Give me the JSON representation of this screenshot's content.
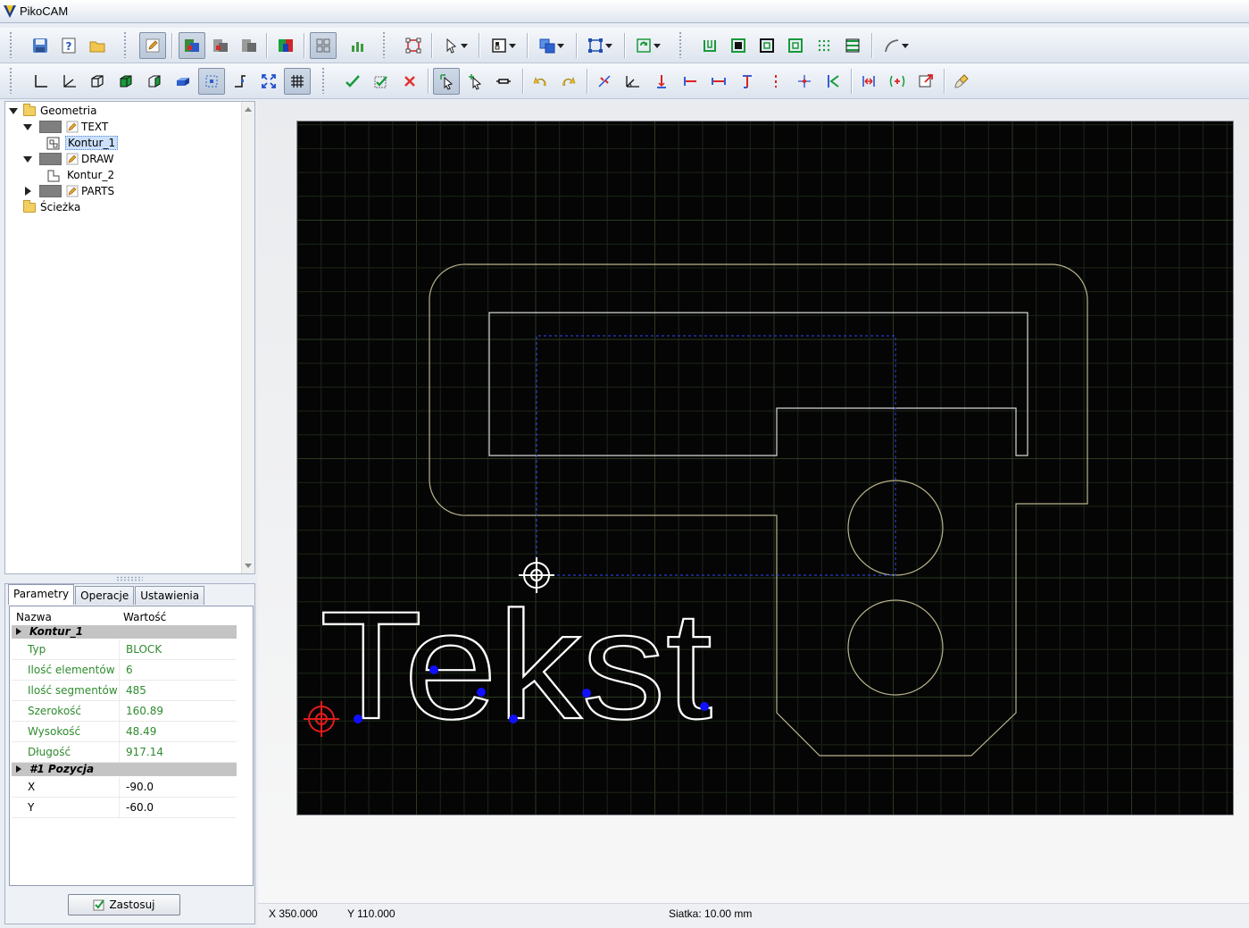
{
  "app": {
    "title": "PikoCAM"
  },
  "tree": {
    "root_label": "Geometria",
    "layer_text": "TEXT",
    "item_kontur1": "Kontur_1",
    "layer_draw": "DRAW",
    "item_kontur2": "Kontur_2",
    "layer_parts": "PARTS",
    "path_label": "Ścieżka"
  },
  "tabs": [
    "Parametry",
    "Operacje",
    "Ustawienia"
  ],
  "properties": {
    "col_name": "Nazwa",
    "col_value": "Wartość",
    "group1": "Kontur_1",
    "rows": [
      {
        "key": "Typ",
        "value": "BLOCK"
      },
      {
        "key": "Ilość elementów",
        "value": "6"
      },
      {
        "key": "Ilość segmentów",
        "value": "485"
      },
      {
        "key": "Szerokość",
        "value": "160.89"
      },
      {
        "key": "Wysokość",
        "value": "48.49"
      },
      {
        "key": "Długość",
        "value": "917.14"
      }
    ],
    "group2": "#1 Pozycja",
    "pos_rows": [
      {
        "key": "X",
        "value": "-90.0"
      },
      {
        "key": "Y",
        "value": "-60.0"
      }
    ],
    "apply_label": "Zastosuj"
  },
  "canvas": {
    "text": "Tekst",
    "colors": {
      "background": "#050505",
      "grid_minor": "#1d2618",
      "grid_major": "#2c3a22",
      "part_outline": "#b9b48c",
      "inner_outline": "#d8d8d8",
      "path_dash": "#2a3acc",
      "text_outline": "#ffffff",
      "node": "#1010ff",
      "origin": "#e21b1b"
    }
  },
  "status": {
    "x": "X 350.000",
    "y": "Y 110.000",
    "grid": "Siatka: 10.00 mm"
  }
}
